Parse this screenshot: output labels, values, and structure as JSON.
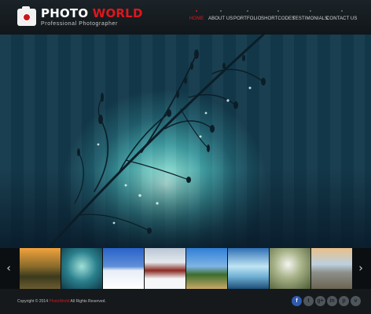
{
  "logo": {
    "word1": "PHOTO",
    "word2": "WORLD",
    "tagline": "Professional Photographer"
  },
  "nav": {
    "items": [
      {
        "label": "HOME",
        "active": true
      },
      {
        "label": "ABOUT US",
        "active": false
      },
      {
        "label": "PORTFOLIO",
        "active": false
      },
      {
        "label": "SHORTCODES",
        "active": false
      },
      {
        "label": "TESTIMONIALS",
        "active": false
      },
      {
        "label": "CONTACT US",
        "active": false
      }
    ]
  },
  "gallery": {
    "prev": "‹",
    "next": "›"
  },
  "footer": {
    "copyright_prefix": "Copyright © 2014",
    "brand": "PhotoWorld",
    "copyright_suffix": "All Rights Reserved."
  },
  "socials": [
    {
      "icon": "facebook-icon",
      "glyph": "f"
    },
    {
      "icon": "twitter-icon",
      "glyph": "t"
    },
    {
      "icon": "google-plus-icon",
      "glyph": "g+"
    },
    {
      "icon": "linkedin-icon",
      "glyph": "in"
    },
    {
      "icon": "pinterest-icon",
      "glyph": "p"
    },
    {
      "icon": "vimeo-icon",
      "glyph": "v"
    }
  ],
  "colors": {
    "accent": "#e0161c",
    "header_bg": "#161c20",
    "footer_bg": "#15191c"
  }
}
